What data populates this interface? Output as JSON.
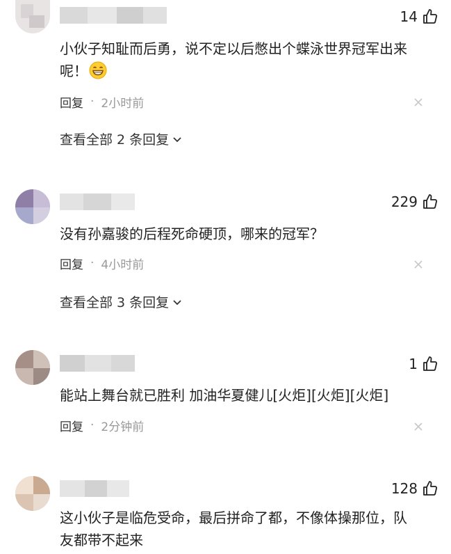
{
  "comments": [
    {
      "likes": "14",
      "text_lines": [
        "小伙子知耻而后勇，说不定以后憋出个蝶泳世界冠军出来",
        "呢！"
      ],
      "reply": "回复",
      "time": "2小时前",
      "view_replies": "查看全部 2 条回复",
      "has_emoji": true,
      "emoji_icon": "grinning-face-icon"
    },
    {
      "likes": "229",
      "text_lines": [
        "没有孙嘉骏的后程死命硬顶，哪来的冠军？"
      ],
      "reply": "回复",
      "time": "4小时前",
      "view_replies": "查看全部 3 条回复"
    },
    {
      "likes": "1",
      "text_lines": [
        "能站上舞台就已胜利 加油华夏健儿[火炬][火炬][火炬]"
      ],
      "reply": "回复",
      "time": "2分钟前"
    },
    {
      "likes": "128",
      "text_lines": [
        "这小伙子是临危受命，最后拼命了都，不像体操那位，队",
        "友都带不起来"
      ]
    }
  ],
  "dot_separator": "·",
  "icons": {
    "like": "thumbs-up-icon",
    "close": "close-icon",
    "expand": "chevron-down-icon"
  },
  "colors": {
    "text": "#222222",
    "meta": "#999999"
  }
}
